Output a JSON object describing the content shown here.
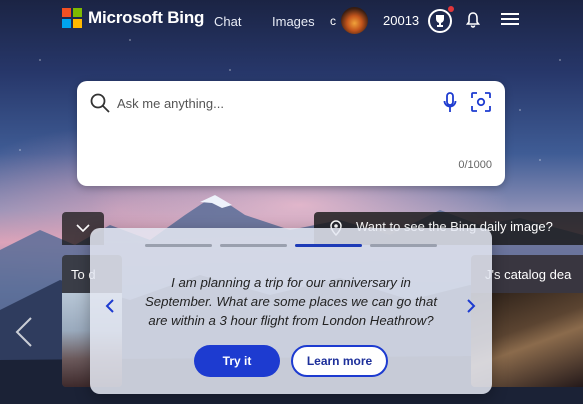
{
  "header": {
    "brand": "Microsoft Bing",
    "nav": [
      {
        "label": "Chat"
      },
      {
        "label": "Images"
      }
    ],
    "profile_initial": "c",
    "points": "20013",
    "icons": [
      "microsoft-logo",
      "avatar",
      "trophy-icon",
      "bell-icon",
      "menu-icon"
    ]
  },
  "search": {
    "placeholder": "Ask me anything...",
    "char_count": "0/1000"
  },
  "daily_image": {
    "label": "Want to see the Bing daily image?"
  },
  "cards": {
    "left_title": "To d",
    "right_title": "J's catalog dea"
  },
  "popup": {
    "prompt": "I am planning a trip for our anniversary in September. What are some places we can go that are within a 3 hour flight from London Heathrow?",
    "try_label": "Try it",
    "learn_label": "Learn more",
    "progress_count": 4,
    "active_step": 3
  },
  "colors": {
    "accent": "#1d3bd0",
    "notification": "#e0363b",
    "logo_red": "#f25022",
    "logo_green": "#7fba00",
    "logo_blue": "#00a4ef",
    "logo_yellow": "#ffb900"
  }
}
